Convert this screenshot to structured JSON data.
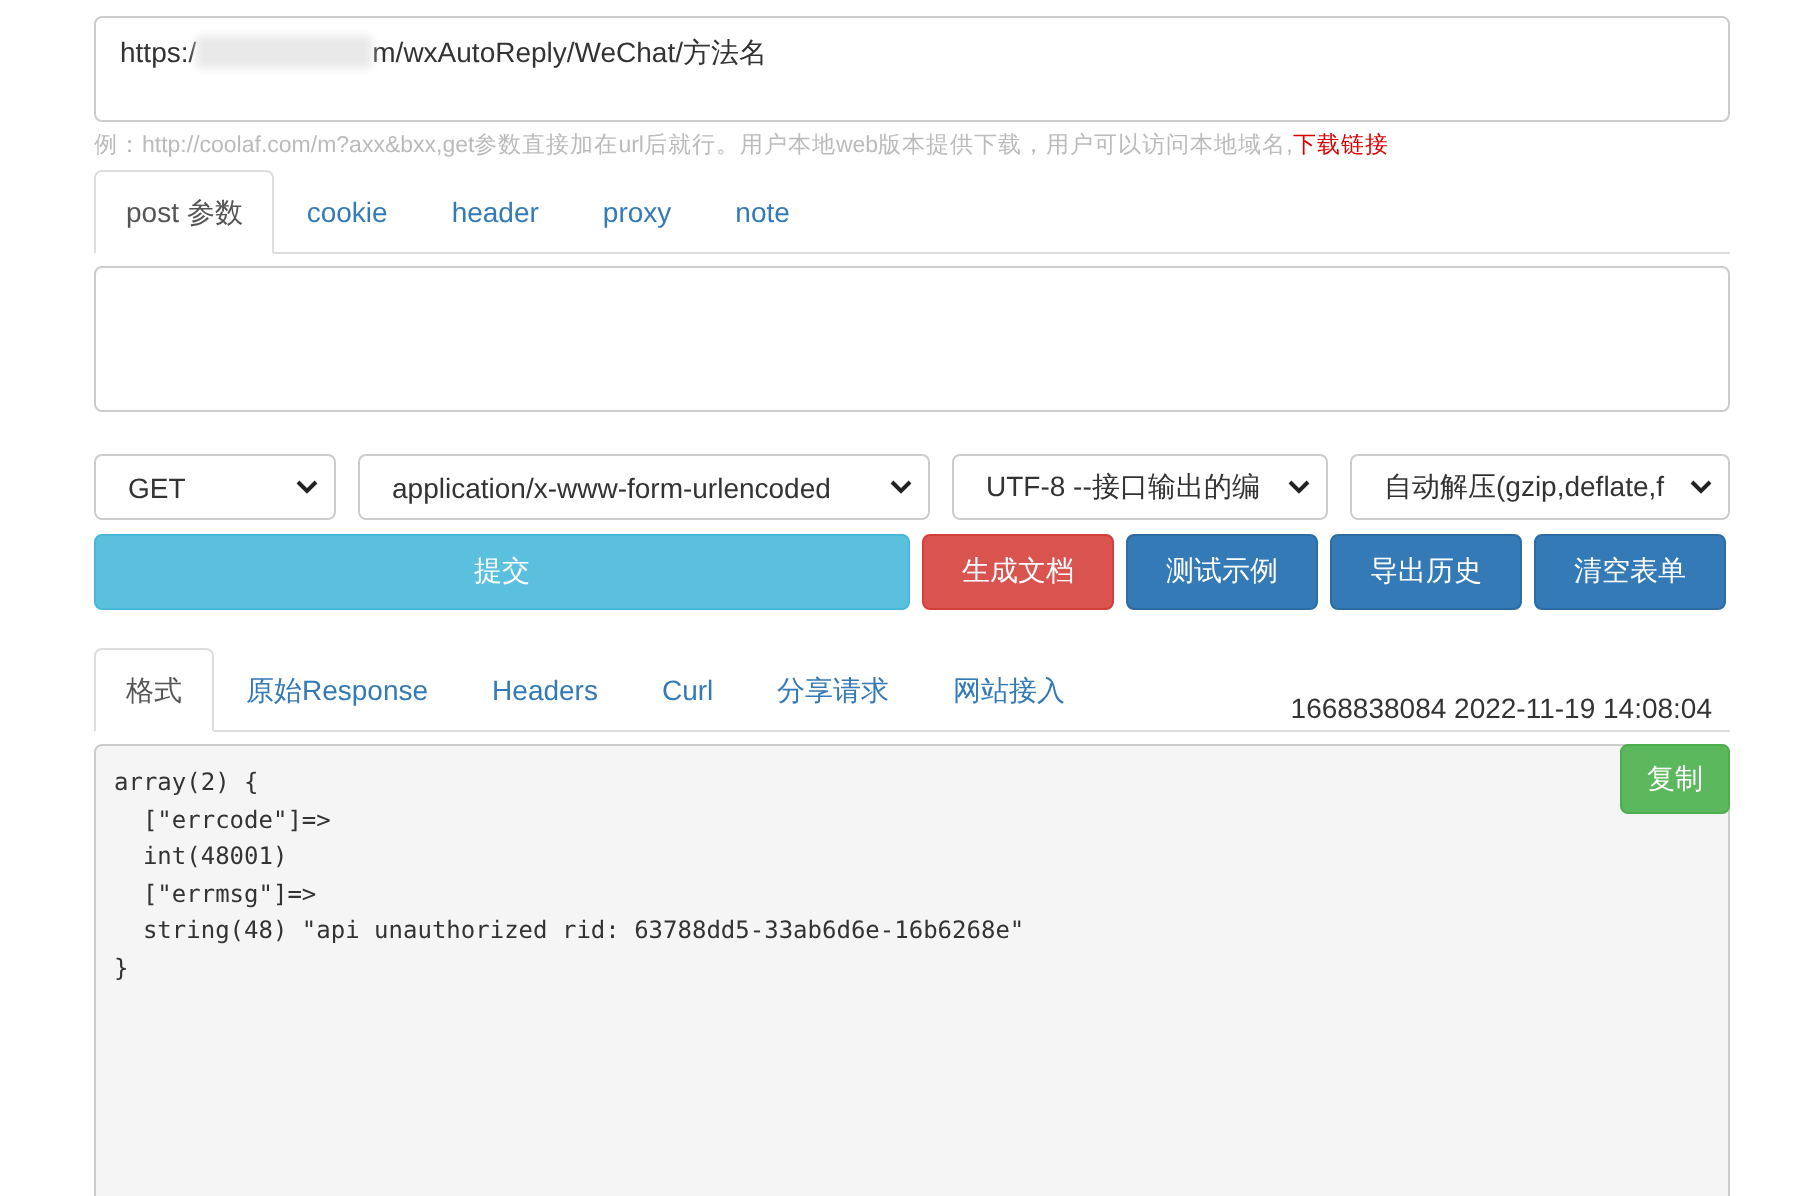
{
  "url_field": {
    "value_start": "https:/",
    "value_end": "m/wxAutoReply/WeChat/方法名"
  },
  "hint": {
    "text": "例：http://coolaf.com/m?axx&bxx,get参数直接加在url后就行。用户本地web版本提供下载，用户可以访问本地域名,",
    "link": "下载链接"
  },
  "request_tabs": [
    {
      "label": "post 参数",
      "selected": true
    },
    {
      "label": "cookie",
      "selected": false
    },
    {
      "label": "header",
      "selected": false
    },
    {
      "label": "proxy",
      "selected": false
    },
    {
      "label": "note",
      "selected": false
    }
  ],
  "selects": [
    {
      "value": "GET"
    },
    {
      "value": "application/x-www-form-urlencoded"
    },
    {
      "value": "UTF-8 --接口输出的编"
    },
    {
      "value": "自动解压(gzip,deflate,f"
    }
  ],
  "buttons": [
    {
      "label": "提交",
      "kind": "info"
    },
    {
      "label": "生成文档",
      "kind": "danger"
    },
    {
      "label": "测试示例",
      "kind": "primary"
    },
    {
      "label": "导出历史",
      "kind": "primary"
    },
    {
      "label": "清空表单",
      "kind": "primary"
    }
  ],
  "result_tabs": [
    {
      "label": "格式",
      "selected": true
    },
    {
      "label": "原始Response",
      "selected": false
    },
    {
      "label": "Headers",
      "selected": false
    },
    {
      "label": "Curl",
      "selected": false
    },
    {
      "label": "分享请求",
      "selected": false
    },
    {
      "label": "网站接入",
      "selected": false
    }
  ],
  "timestamp": "1668838084 2022-11-19 14:08:04",
  "output": {
    "lines": [
      "array(2) {",
      "  [\"errcode\"]=>",
      "  int(48001)",
      "  [\"errmsg\"]=>",
      "  string(48) \"api unauthorized rid: 63788dd5-33ab6d6e-16b6268e\"",
      "}"
    ],
    "copy_button": "复制"
  }
}
